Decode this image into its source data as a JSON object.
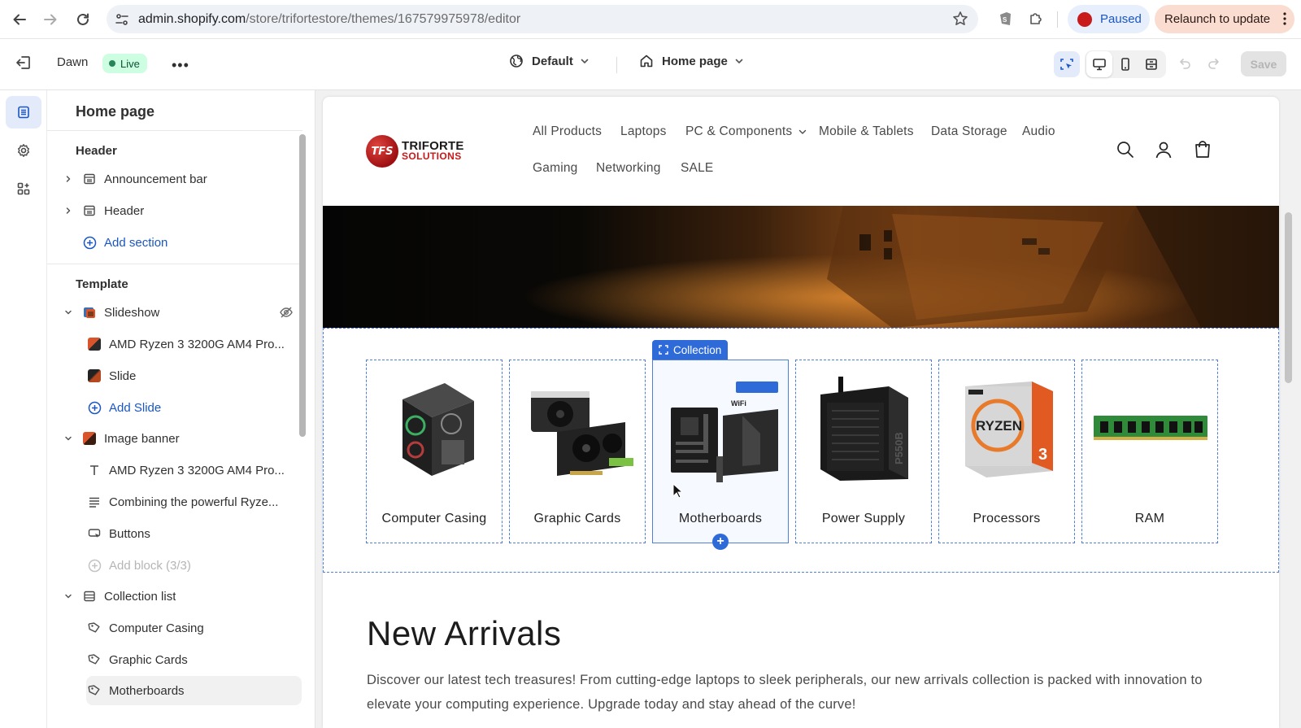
{
  "browser": {
    "url_host": "admin.shopify.com",
    "url_path": "/store/trifortestore/themes/167579975978/editor",
    "profile_status": "Paused",
    "relaunch_label": "Relaunch to update"
  },
  "editor": {
    "theme_name": "Dawn",
    "live_label": "Live",
    "more_label": "•••",
    "context_select": "Default",
    "page_select": "Home page",
    "save_label": "Save"
  },
  "sidebar": {
    "title": "Home page",
    "header_group": {
      "label": "Header",
      "items": [
        {
          "label": "Announcement bar",
          "icon": "section-icon"
        },
        {
          "label": "Header",
          "icon": "section-icon"
        }
      ],
      "add_section": "Add section"
    },
    "template_group": {
      "label": "Template",
      "slideshow": {
        "label": "Slideshow",
        "children": [
          "AMD Ryzen 3 3200G AM4 Pro...",
          "Slide"
        ],
        "add_slide": "Add Slide"
      },
      "image_banner": {
        "label": "Image banner",
        "children": [
          {
            "label": "AMD Ryzen 3 3200G AM4 Pro...",
            "icon": "text-icon"
          },
          {
            "label": "Combining the powerful Ryze...",
            "icon": "paragraph-icon"
          },
          {
            "label": "Buttons",
            "icon": "button-icon"
          }
        ],
        "add_block": "Add block (3/3)"
      },
      "collection_list": {
        "label": "Collection list",
        "children": [
          "Computer Casing",
          "Graphic Cards",
          "Motherboards"
        ]
      }
    }
  },
  "store": {
    "logo_line1": "TRIFORTE",
    "logo_line2": "SOLUTIONS",
    "logo_mark": "TFS",
    "nav": [
      "All Products",
      "Laptops",
      "PC & Components",
      "Mobile & Tablets",
      "Data Storage",
      "Audio",
      "Gaming",
      "Networking",
      "SALE"
    ],
    "collection_tag": "Collection",
    "collections": [
      "Computer Casing",
      "Graphic Cards",
      "Motherboards",
      "Power Supply",
      "Processors",
      "RAM"
    ],
    "product_text": {
      "ryzen": "RYZEN",
      "ryzen_num": "3",
      "psu": "P550B",
      "wifi": "WiFi"
    },
    "new_arrivals_title": "New Arrivals",
    "new_arrivals_desc": "Discover our latest tech treasures! From cutting-edge laptops to sleek peripherals, our new arrivals collection is packed with innovation to elevate your computing experience. Upgrade today and stay ahead of the curve!"
  },
  "colors": {
    "accent": "#2f6bd8",
    "live_bg": "#cdfee1",
    "brand_red": "#c8191b"
  }
}
